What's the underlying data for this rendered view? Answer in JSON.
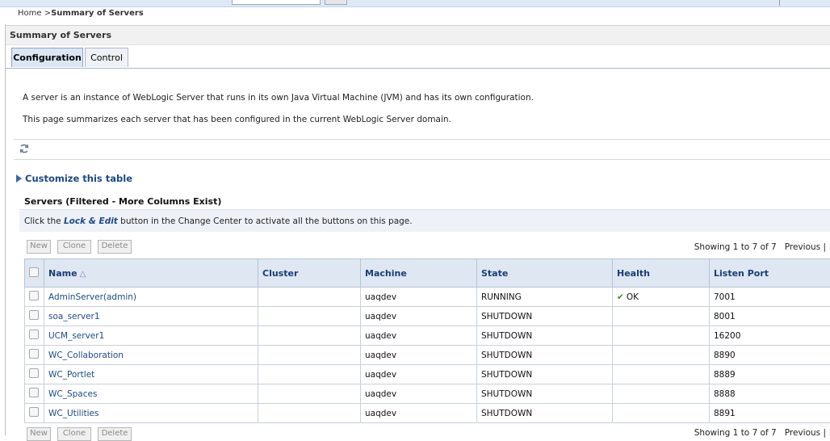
{
  "breadcrumb": {
    "home": "Home >",
    "current": "Summary of Servers"
  },
  "page_title": "Summary of Servers",
  "tabs": [
    {
      "label": "Configuration"
    },
    {
      "label": "Control"
    }
  ],
  "description": {
    "line1": "A server is an instance of WebLogic Server that runs in its own Java Virtual Machine (JVM) and has its own configuration.",
    "line2": "This page summarizes each server that has been configured in the current WebLogic Server domain."
  },
  "customize_label": "Customize this table",
  "table_title": "Servers (Filtered - More Columns Exist)",
  "info": {
    "before": "Click the ",
    "link": "Lock & Edit",
    "after": " button in the Change Center to activate all the buttons on this page."
  },
  "actions": {
    "new": "New",
    "clone": "Clone",
    "delete": "Delete"
  },
  "pagination": {
    "showing": "Showing 1 to 7 of 7",
    "previous": "Previous |"
  },
  "columns": {
    "name": "Name",
    "cluster": "Cluster",
    "machine": "Machine",
    "state": "State",
    "health": "Health",
    "listen_port": "Listen Port"
  },
  "rows": [
    {
      "name": "AdminServer(admin)",
      "cluster": "",
      "machine": "uaqdev",
      "state": "RUNNING",
      "health": "OK",
      "port": "7001"
    },
    {
      "name": "soa_server1",
      "cluster": "",
      "machine": "uaqdev",
      "state": "SHUTDOWN",
      "health": "",
      "port": "8001"
    },
    {
      "name": "UCM_server1",
      "cluster": "",
      "machine": "uaqdev",
      "state": "SHUTDOWN",
      "health": "",
      "port": "16200"
    },
    {
      "name": "WC_Collaboration",
      "cluster": "",
      "machine": "uaqdev",
      "state": "SHUTDOWN",
      "health": "",
      "port": "8890"
    },
    {
      "name": "WC_Portlet",
      "cluster": "",
      "machine": "uaqdev",
      "state": "SHUTDOWN",
      "health": "",
      "port": "8889"
    },
    {
      "name": "WC_Spaces",
      "cluster": "",
      "machine": "uaqdev",
      "state": "SHUTDOWN",
      "health": "",
      "port": "8888"
    },
    {
      "name": "WC_Utilities",
      "cluster": "",
      "machine": "uaqdev",
      "state": "SHUTDOWN",
      "health": "",
      "port": "8891"
    }
  ],
  "colors": {
    "link": "#1a4a8a",
    "header_bg": "#dfe7f2",
    "ok_check": "#2e8b2e"
  },
  "icons": {
    "refresh": "refresh-icon",
    "expand": "expand-triangle-icon",
    "sort": "sort-ascending-icon",
    "health_ok": "check-icon"
  }
}
